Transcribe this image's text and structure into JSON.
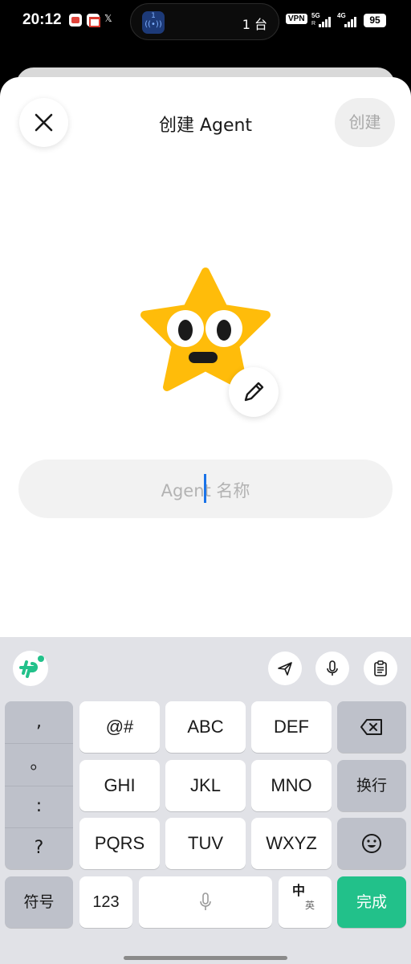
{
  "status_bar": {
    "time": "20:12",
    "notif_x": "𝕏",
    "island_badge": "1",
    "island_wave": "((•))",
    "island_count": "1 台",
    "vpn": "VPN",
    "signal1": {
      "label": "5G",
      "sub": "R"
    },
    "signal2": {
      "label": "4G"
    },
    "battery": "95"
  },
  "sheet": {
    "title": "创建 Agent",
    "create_label": "创建",
    "close_icon": "close-icon",
    "avatar": {
      "icon": "star-face",
      "color": "#FFBC0A"
    },
    "edit_icon": "pencil-icon",
    "name_input": {
      "placeholder": "Agent 名称",
      "value": ""
    }
  },
  "keyboard": {
    "toolbar": {
      "logo": "input-method-logo",
      "tools": [
        "send-icon",
        "microphone-icon",
        "clipboard-icon"
      ]
    },
    "punctuation": [
      ",",
      "。",
      ":",
      "?"
    ],
    "rows": [
      [
        "@#",
        "ABC",
        "DEF"
      ],
      [
        "GHI",
        "JKL",
        "MNO"
      ],
      [
        "PQRS",
        "TUV",
        "WXYZ"
      ]
    ],
    "backspace_icon": "backspace-icon",
    "line_feed": "换行",
    "emoji_icon": "emoji-icon",
    "symbols": "符号",
    "numbers": "123",
    "space_icon": "microphone-icon",
    "lang_top": "中",
    "lang_bottom": "英",
    "done": "完成",
    "accent": "#22C18A"
  }
}
